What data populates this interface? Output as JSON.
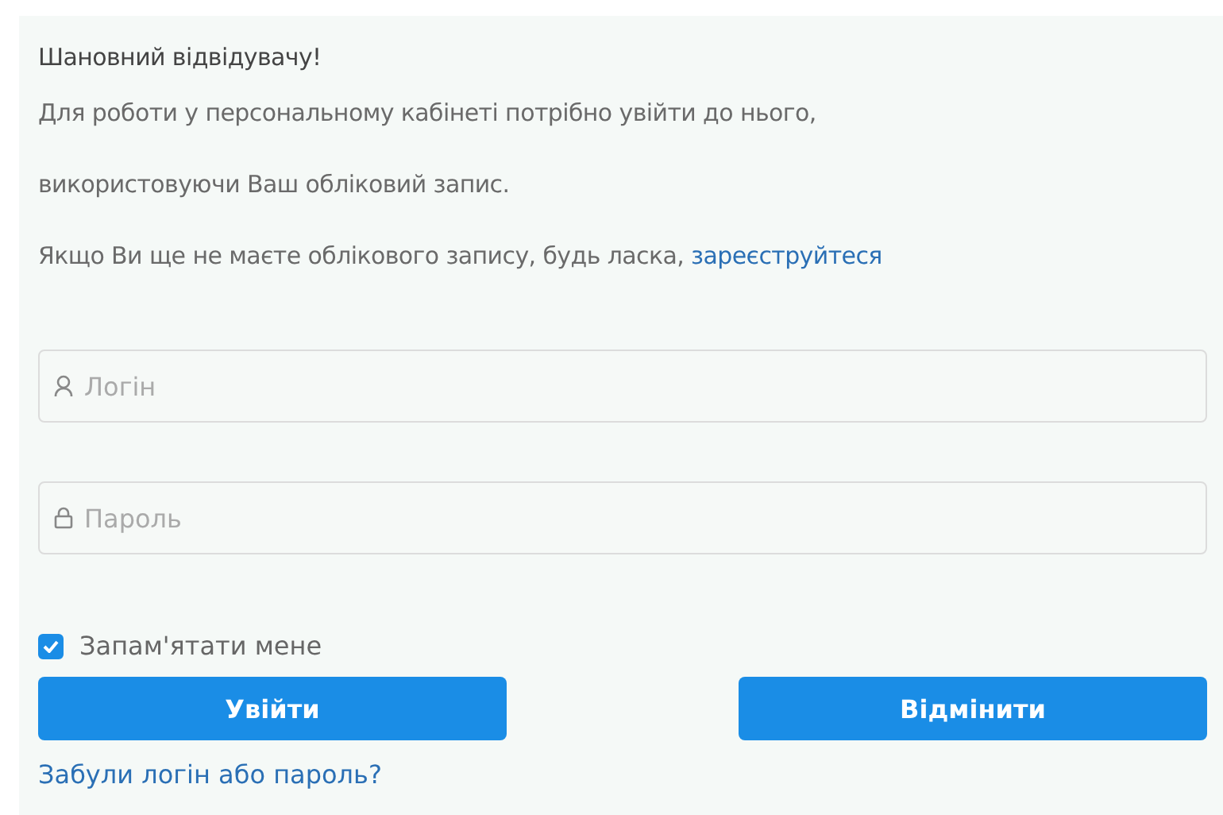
{
  "greeting": "Шановний відвідувачу!",
  "intro_lines": [
    "Для роботи у персональному кабінеті потрібно увійти до нього,",
    "використовуючи Ваш обліковий запис."
  ],
  "register_prompt": {
    "text": "Якщо Ви ще не маєте облікового запису, будь ласка,",
    "link": "зареєструйтеся"
  },
  "fields": [
    {
      "kind": "login",
      "placeholder": "Логін"
    },
    {
      "kind": "password",
      "placeholder": "Пароль"
    }
  ],
  "remember": {
    "label": "Запам'ятати мене",
    "checked": true
  },
  "buttons": [
    "Увійти",
    "Відмінити"
  ],
  "forgot_link": "Забули логін або пароль?"
}
